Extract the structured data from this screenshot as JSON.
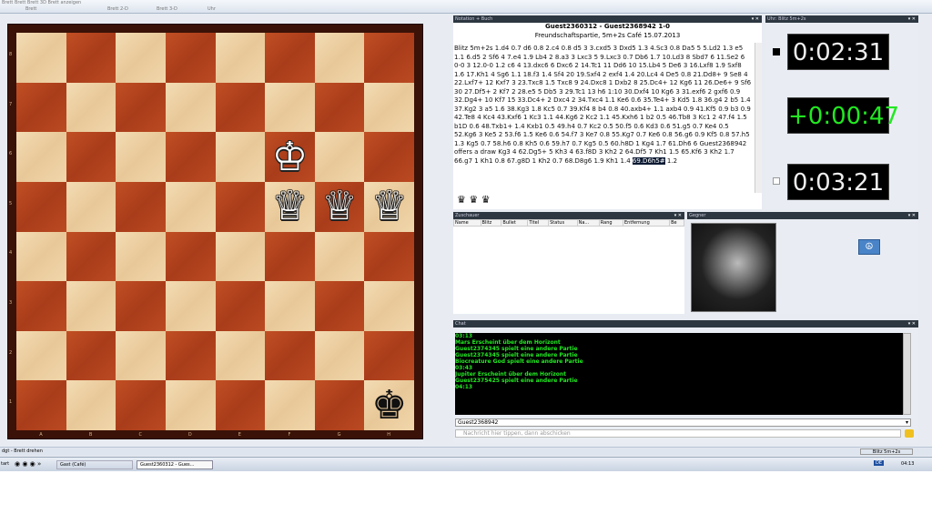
{
  "ribbon": {
    "groups": [
      "Brett",
      "Brett 2-D",
      "Brett 3-D",
      "Uhr"
    ],
    "truncated": "Brett Brett Brett 3D Brett anzeigen"
  },
  "board": {
    "files": [
      "A",
      "B",
      "C",
      "D",
      "E",
      "F",
      "G",
      "H"
    ],
    "ranks": [
      "8",
      "7",
      "6",
      "5",
      "4",
      "3",
      "2",
      "1"
    ],
    "pieces": [
      {
        "glyph": "♔",
        "color": "white",
        "square": "f6"
      },
      {
        "glyph": "♕",
        "color": "white",
        "square": "f5"
      },
      {
        "glyph": "♕",
        "color": "white",
        "square": "g5"
      },
      {
        "glyph": "♕",
        "color": "white",
        "square": "h5"
      },
      {
        "glyph": "♚",
        "color": "black",
        "square": "h1"
      }
    ]
  },
  "notation": {
    "header": "Notation + Buch",
    "title": "Guest2360312 - Guest2368942  1-0",
    "subtitle": "Freundschaftspartie, 5m+2s Café 15.07.2013",
    "moves_text": "Blitz 5m+2s 1.d4 0.7 d6 0.8 2.c4 0.8 d5 3 3.cxd5 3 Dxd5 1.3 4.Sc3 0.8 Da5 5 5.Ld2 1.3 e5 1.1 6.d5 2 Sf6 4 7.e4 1.9 Lb4 2 8.a3 3 Lxc3 5 9.Lxc3 0.7 Db6 1.7 10.Ld3 8 Sbd7 6 11.Se2 6 0-0 3 12.0-0 1.2 c6 4 13.dxc6 6 Dxc6 2 14.Tc1 11 Dd6 10 15.Lb4 5 De6 3 16.Lxf8 1.9 Sxf8 1.6 17.Kh1 4 Sg6 1.1 18.f3 1.4 Sf4 20 19.Sxf4 2 exf4 1.4 20.Lc4 4 De5 0.8 21.Dd8+ 9 Se8 4 22.Lxf7+ 12 Kxf7 3 23.Txc8 1.5 Txc8 9 24.Dxc8 1 Dxb2 8 25.Dc4+ 12 Kg6 11 26.De6+ 9 Sf6 30 27.Df5+ 2 Kf7 2 28.e5 5 Db5 3 29.Tc1 13 h6 1:10 30.Dxf4 10 Kg6 3 31.exf6 2 gxf6 0.9 32.Dg4+ 10 Kf7 15 33.Dc4+ 2 Dxc4 2 34.Txc4 1.1 Ke6 0.6 35.Te4+ 3 Kd5 1.8 36.g4 2 b5 1.4 37.Kg2 3 a5 1.6 38.Kg3 1.8 Kc5 0.7 39.Kf4 8 b4 0.8 40.axb4+ 1.1 axb4 0.9 41.Kf5 0.9 b3 0.9 42.Te8 4 Kc4 43.Kxf6 1 Kc3 1.1 44.Kg6 2 Kc2 1.1 45.Kxh6 1 b2 0.5 46.Tb8 3 Kc1 2 47.f4 1.5 b1D 0.6 48.Txb1+ 1.4 Kxb1 0.5 49.h4 0.7 Kc2 0.5 50.f5 0.6 Kd3 0.6 51.g5 0.7 Ke4 0.5 52.Kg6 3 Ke5 2 53.f6 1.5 Ke6 0.6 54.f7 3 Ke7 0.8 55.Kg7 0.7 Ke6 0.8 56.g6 0.9 Kf5 0.8 57.h5 1.3 Kg5 0.7 58.h6 0.8 Kh5 0.6 59.h7 0.7 Kg5 0.5 60.h8D 1 Kg4 1.7 61.Dh6 6 Guest2368942 offers a draw Kg3 4 62.Dg5+ 5 Kh3 4 63.f8D 3 Kh2 2 64.Df5 7 Kh1 1.5 65.Kf6 3 Kh2 1.7 66.g7 1 Kh1 0.8 67.g8D 1 Kh2 0.7 68.D8g6 1.9 Kh1 1.4",
    "last_move": "69.D6h5#",
    "last_time": "1.2",
    "captured": "♛ ♛ ♛"
  },
  "clock": {
    "header": "Uhr: Blitz 5m+2s",
    "top": "0:02:31",
    "increment": "+0:00:47",
    "bottom": "0:03:21"
  },
  "watchers": {
    "header": "Zuschauer",
    "columns": [
      "Name",
      "Blitz",
      "Bullet",
      "Titel",
      "Status",
      "Na...",
      "Rang",
      "Entfernung",
      "Be"
    ]
  },
  "opponent": {
    "header": "Gegner"
  },
  "chat": {
    "header": "Chat",
    "lines": [
      "03:13",
      "Mars Erscheint über dem Horizont",
      "Guest2374345 spielt eine andere Partie",
      "Guest2374345 spielt eine andere Partie",
      "Biocreature God spielt eine andere Partie",
      "03:43",
      "Jupiter Erscheint über dem Horizont",
      "Guest2375425 spielt eine andere Partie",
      "04:13"
    ],
    "recipient": "Guest2368942",
    "input_placeholder": "Nachricht hier tippen, dann abschicken"
  },
  "status": {
    "left": "dgt - Brett drehen",
    "right": "Blitz 5m+2s"
  },
  "taskbar": {
    "start": "tart",
    "item1": "Gast (Café)",
    "item2": "Guest2360312 - Gues...",
    "time": "04:13",
    "lang": "DE"
  },
  "colors": {
    "clock_green": "#22e822",
    "chat_green": "#22e822",
    "dark_square": "#a93c1a",
    "light_square": "#e8c898"
  }
}
